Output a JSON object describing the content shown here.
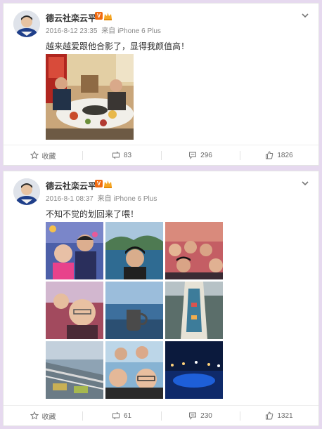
{
  "posts": [
    {
      "username": "德云社栾云平",
      "vip_badge": "V",
      "date": "2016-8-12 23:35",
      "source_prefix": "来自",
      "source": "iPhone 6 Plus",
      "text": "越来越爱跟他合影了，显得我颜值高！",
      "actions": {
        "favorite_label": "收藏",
        "repost_count": "83",
        "comment_count": "296",
        "like_count": "1826"
      }
    },
    {
      "username": "德云社栾云平",
      "vip_badge": "V",
      "date": "2016-8-1 08:37",
      "source_prefix": "来自",
      "source": "iPhone 6 Plus",
      "text": "不知不觉的划回来了喂！",
      "actions": {
        "favorite_label": "收藏",
        "repost_count": "61",
        "comment_count": "230",
        "like_count": "1321"
      }
    }
  ],
  "colors": {
    "page_background": "#e6d9ef",
    "card_background": "#ffffff",
    "vip_badge": "#f06a10",
    "muted_text": "#888888"
  },
  "icons": {
    "menu": "chevron-down-icon",
    "favorite": "star-icon",
    "repost": "repost-icon",
    "comment": "comment-icon",
    "like": "thumbs-up-icon"
  }
}
